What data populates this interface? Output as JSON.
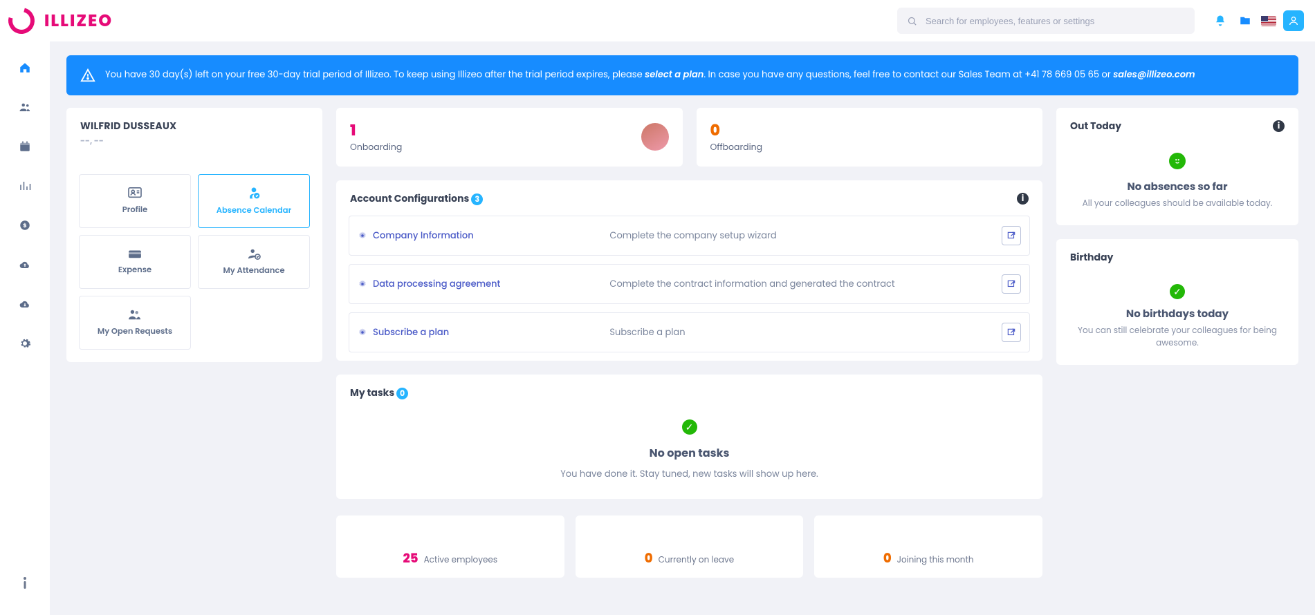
{
  "header": {
    "brand": "ILLIZEO",
    "search_placeholder": "Search for employees, features or settings"
  },
  "banner": {
    "prefix": "You have 30 day(s) left on your free 30-day trial period of Illizeo. To keep using Illizeo after the trial period expires, please ",
    "plan_text": "select a plan",
    "middle": ". In case you have any questions, feel free to contact our Sales Team at +41 78 669 05 65 or ",
    "email": "sales@illizeo.com"
  },
  "user_card": {
    "name": "WILFRID DUSSEAUX",
    "subtitle": "--, --",
    "tiles": {
      "profile": "Profile",
      "absence": "Absence Calendar",
      "expense": "Expense",
      "attendance": "My Attendance",
      "requests": "My Open Requests"
    }
  },
  "stats": {
    "onboarding": {
      "value": "1",
      "label": "Onboarding"
    },
    "offboarding": {
      "value": "0",
      "label": "Offboarding"
    }
  },
  "account_cfg": {
    "title": "Account Configurations",
    "count": "3",
    "rows": [
      {
        "title": "Company Information",
        "desc": "Complete the company setup wizard"
      },
      {
        "title": "Data processing agreement",
        "desc": "Complete the contract information and generated the contract"
      },
      {
        "title": "Subscribe a plan",
        "desc": "Subscribe a plan"
      }
    ]
  },
  "tasks": {
    "title": "My tasks",
    "count": "0",
    "empty_title": "No open tasks",
    "empty_sub": "You have done it. Stay tuned, new tasks will show up here."
  },
  "bottom": {
    "active": {
      "value": "25",
      "label": "Active employees"
    },
    "leave": {
      "value": "0",
      "label": "Currently on leave"
    },
    "joining": {
      "value": "0",
      "label": "Joining this month"
    }
  },
  "out_today": {
    "title": "Out Today",
    "headline": "No absences so far",
    "sub": "All your colleagues should be available today."
  },
  "birthday": {
    "title": "Birthday",
    "headline": "No birthdays today",
    "sub": "You can still celebrate your colleagues for being awesome."
  }
}
